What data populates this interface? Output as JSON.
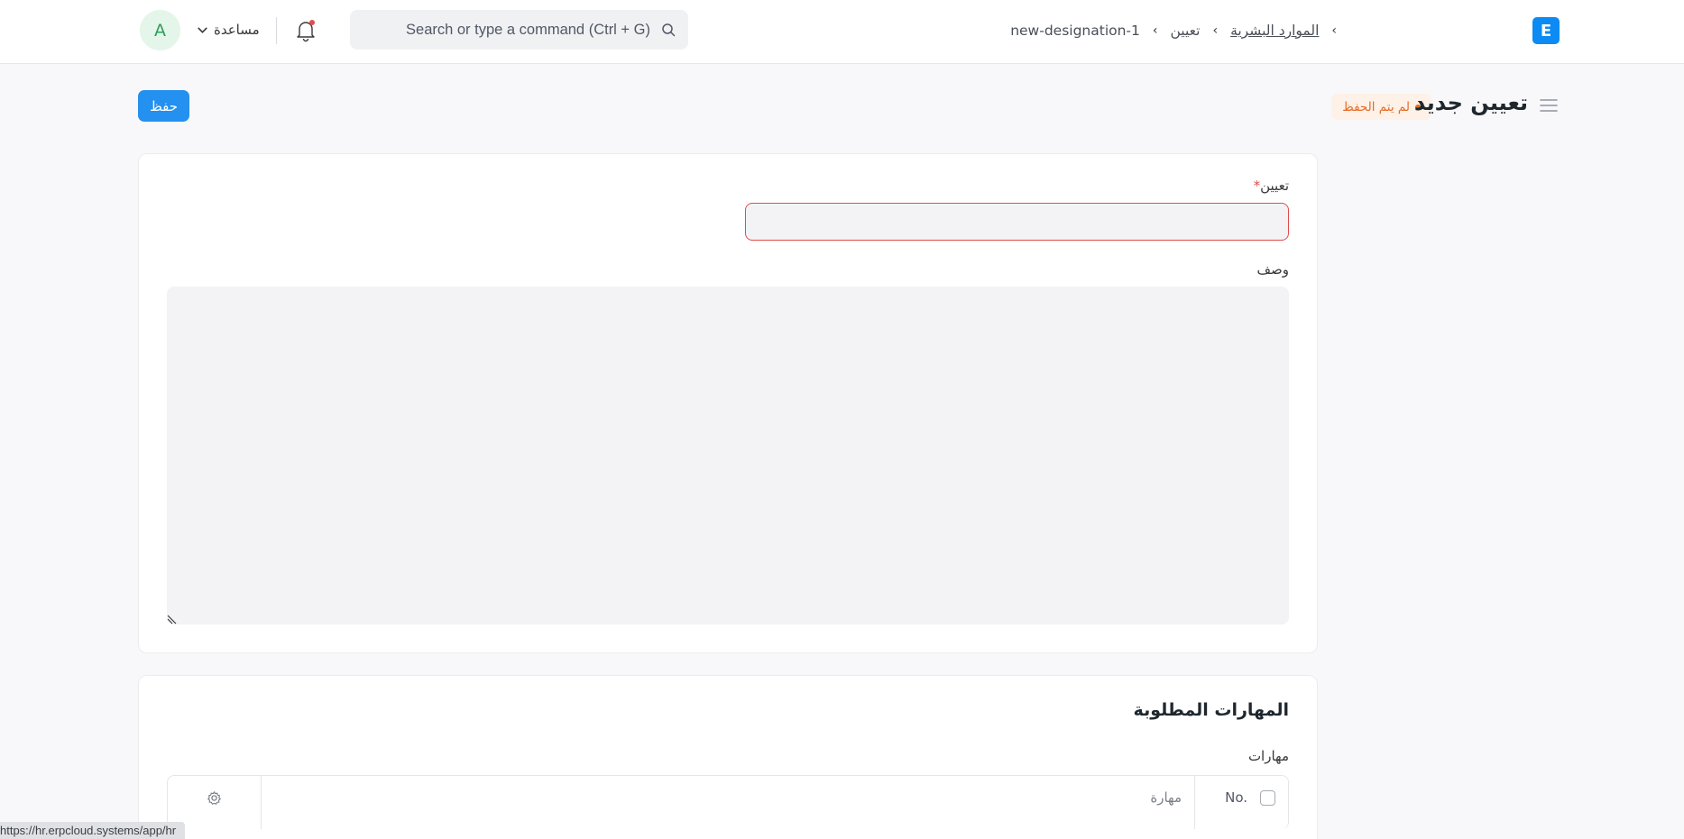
{
  "navbar": {
    "avatar_letter": "A",
    "help_label": "مساعدة",
    "search_placeholder": "Search or type a command (Ctrl + G)",
    "breadcrumb": [
      "الموارد البشرية",
      "تعيين",
      "new-designation-1"
    ],
    "logo_letter": "E",
    "colors": {
      "logo": "#0b8bf3",
      "notification_dot": "#e24c4c"
    }
  },
  "page": {
    "title": "تعيين جديد",
    "status": "لم يتم الحفظ",
    "save_label": "حفظ",
    "colors": {
      "primary": "#2490ef",
      "status_text": "#e56b26"
    }
  },
  "form": {
    "designation_label": "تعيين",
    "designation_required": "*",
    "designation_value": "",
    "description_label": "وصف",
    "description_value": ""
  },
  "skills_section": {
    "title": "المهارات المطلوبة",
    "table_label": "مهارات",
    "columns": {
      "no": "No.",
      "skill": "مهارة"
    }
  },
  "status_bar": {
    "url": "https://hr.erpcloud.systems/app/hr"
  }
}
